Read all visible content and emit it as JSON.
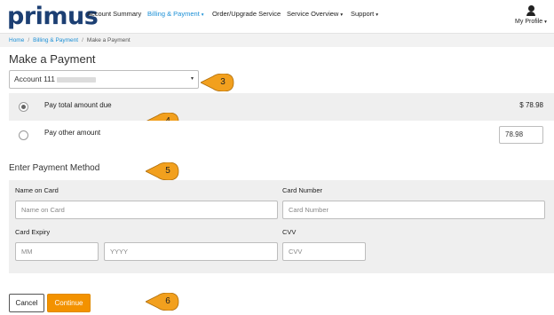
{
  "brand": {
    "logo_text": "primus"
  },
  "nav": {
    "items": [
      {
        "label": "Account Summary",
        "active": false,
        "dropdown": false
      },
      {
        "label": "Billing & Payment",
        "active": true,
        "dropdown": true
      },
      {
        "label": "Order/Upgrade Service",
        "active": false,
        "dropdown": false
      },
      {
        "label": "Service Overview",
        "active": false,
        "dropdown": true
      },
      {
        "label": "Support",
        "active": false,
        "dropdown": true
      }
    ],
    "profile_label": "My Profile",
    "caret": "▾"
  },
  "breadcrumb": {
    "home": "Home",
    "billing": "Billing & Payment",
    "current": "Make a Payment",
    "separator": "/"
  },
  "page_title": "Make a Payment",
  "account_select": {
    "value": "Account 111",
    "caret": "▾"
  },
  "payment_options": {
    "total": {
      "label": "Pay total amount due",
      "amount": "$ 78.98",
      "selected": true
    },
    "other": {
      "label": "Pay other amount",
      "value": "78.98",
      "selected": false
    }
  },
  "payment_method": {
    "title": "Enter Payment Method",
    "name_on_card": {
      "label": "Name on Card",
      "placeholder": "Name on Card"
    },
    "card_number": {
      "label": "Card Number",
      "placeholder": "Card Number"
    },
    "card_expiry": {
      "label": "Card Expiry",
      "month_placeholder": "MM",
      "year_placeholder": "YYYY"
    },
    "cvv": {
      "label": "CVV",
      "placeholder": "CVV"
    }
  },
  "buttons": {
    "cancel": "Cancel",
    "continue": "Continue"
  },
  "callouts": [
    "3",
    "4",
    "5",
    "6"
  ],
  "colors": {
    "brand_navy": "#1c3f73",
    "link_blue": "#1a8fd6",
    "accent_orange": "#f39200",
    "callout_orange": "#f2a01e"
  }
}
